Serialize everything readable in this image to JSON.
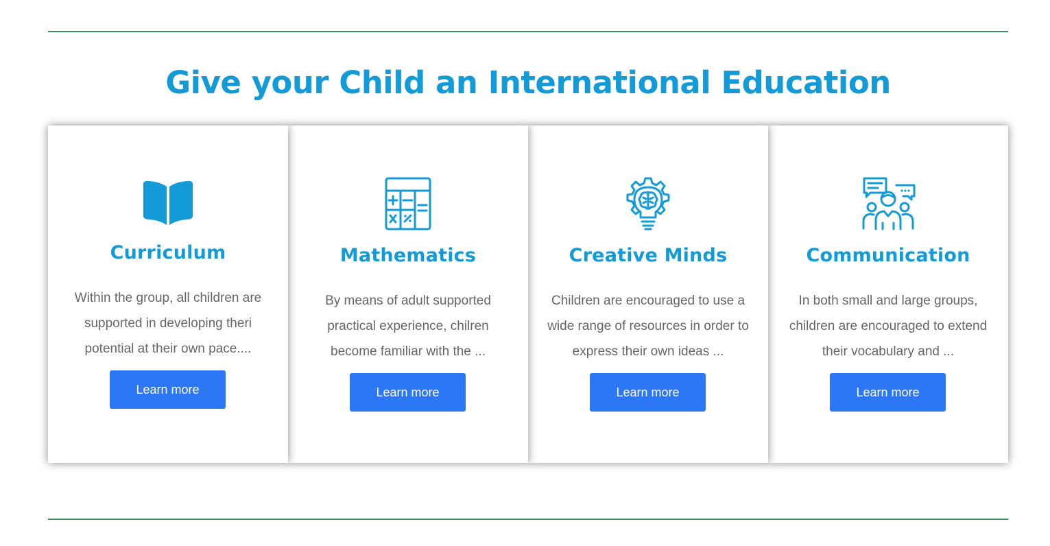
{
  "section": {
    "heading": "Give your Child an International Education",
    "accent_color": "#139bd8",
    "button_color": "#2b77f5",
    "rule_color": "#3f8f63"
  },
  "cards": [
    {
      "icon": "book-icon",
      "title": "Curriculum",
      "text": "Within the group, all children are supported in developing theri potential at their own pace....",
      "button_label": "Learn more"
    },
    {
      "icon": "calculator-icon",
      "title": "Mathematics",
      "text": "By means of adult supported practical experience, chilren become familiar with the ...",
      "button_label": "Learn more"
    },
    {
      "icon": "brain-gear-bulb-icon",
      "title": "Creative Minds",
      "text": "Children are encouraged to use a wide range of resources in order to express their own ideas ...",
      "button_label": "Learn more"
    },
    {
      "icon": "group-chat-icon",
      "title": "Communication",
      "text": "In both small and large groups, children are encouraged to extend their vocabulary and ...",
      "button_label": "Learn more"
    }
  ]
}
